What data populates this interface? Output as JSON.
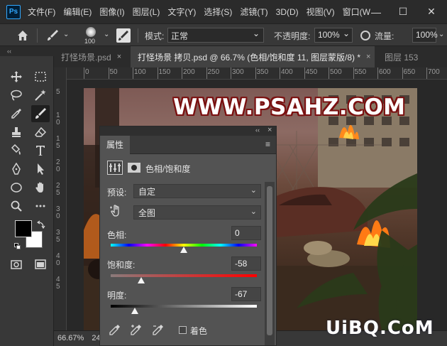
{
  "menubar": {
    "logo": "Ps",
    "items": [
      "文件(F)",
      "编辑(E)",
      "图像(I)",
      "图层(L)",
      "文字(Y)",
      "选择(S)",
      "滤镜(T)",
      "3D(D)",
      "视图(V)",
      "窗口(W"
    ],
    "controls": {
      "minimize": "—",
      "maximize": "☐",
      "close": "✕"
    }
  },
  "optbar": {
    "brush_size": "100",
    "mode_label": "模式:",
    "mode_value": "正常",
    "opacity_label": "不透明度:",
    "opacity_value": "100%",
    "flow_label": "流量:",
    "flow_value": "100%"
  },
  "tabs": [
    {
      "label": "打怪场景.psd",
      "close": "×"
    },
    {
      "label": "打怪场景 拷贝.psd @ 66.7% (色相/饱和度 11, 图层蒙版/8) *",
      "close": "×"
    },
    {
      "label": "图层 153"
    }
  ],
  "toolbar": {
    "collapse": "‹‹"
  },
  "ruler": {
    "top_labels": [
      "0",
      "50",
      "100",
      "150",
      "200",
      "250",
      "300",
      "350",
      "400",
      "450",
      "500",
      "550",
      "600",
      "650",
      "700"
    ],
    "left_labels": [
      "5",
      "1\n0",
      "1\n5",
      "2\n0",
      "2\n5",
      "3\n0",
      "3\n5",
      "4\n0",
      "4\n5"
    ]
  },
  "status": {
    "zoom": "66.67%",
    "extra": "24"
  },
  "watermark": "WWW.PSAHZ.COM",
  "site_logo": "UiBQ.CoM",
  "panel": {
    "collapse": "‹‹",
    "close": "×",
    "tab_title": "属性",
    "menu": "≡",
    "adjustment_title": "色相/饱和度",
    "preset_label": "预设:",
    "preset_value": "自定",
    "channel_value": "全图",
    "hue_label": "色相:",
    "hue_value": "0",
    "saturation_label": "饱和度:",
    "saturation_value": "-58",
    "lightness_label": "明度:",
    "lightness_value": "-67",
    "colorize_label": "着色"
  },
  "slider_levels": {
    "hue_fraction": 0.5,
    "saturation_fraction": 0.21,
    "lightness_fraction": 0.165
  },
  "colors": {
    "menubar_bg": "#2b2b2b",
    "panel_bg": "#535353",
    "watermark_outline": "#7a1010",
    "ps_blue": "#31a8ff"
  }
}
